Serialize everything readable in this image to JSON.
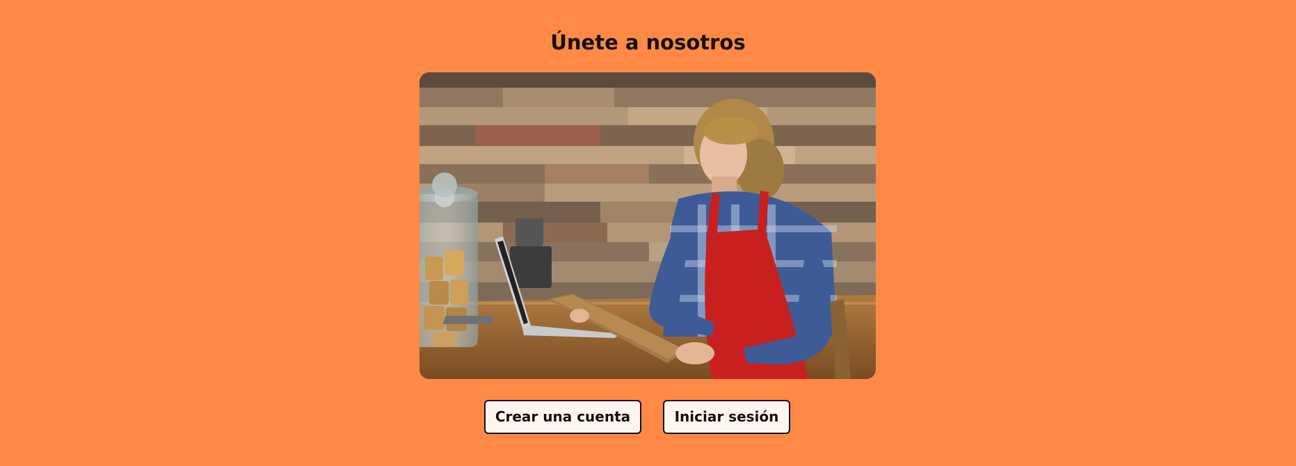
{
  "page": {
    "title": "Únete a nosotros",
    "background_color": "#ff8945"
  },
  "hero_image": {
    "subject": "woman-with-clipboard-at-cafe-counter"
  },
  "actions": {
    "create_account_label": "Crear una cuenta",
    "login_label": "Iniciar sesión"
  }
}
